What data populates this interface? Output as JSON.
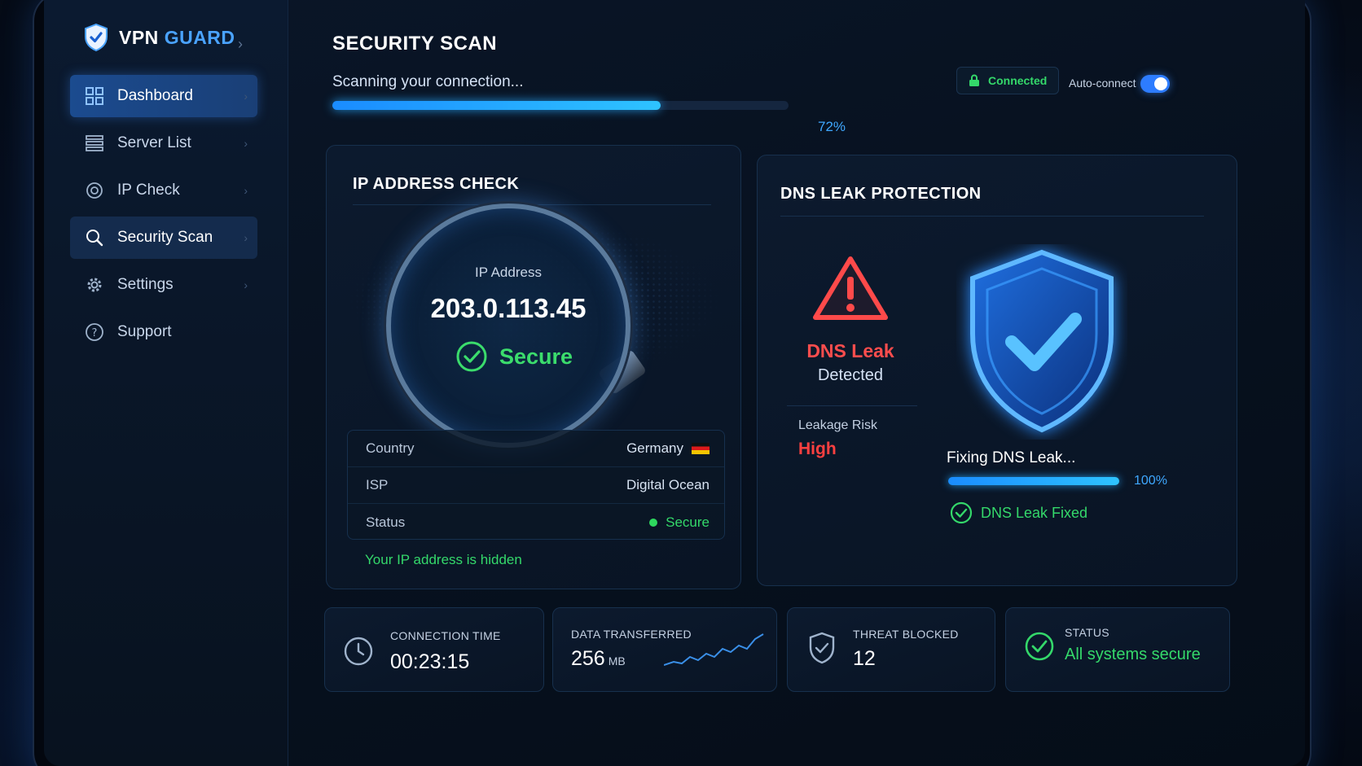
{
  "brand": {
    "name_part1": "VPN",
    "name_part2": "GUARD"
  },
  "sidebar": {
    "items": [
      {
        "label": "Dashboard",
        "icon": "grid-icon"
      },
      {
        "label": "Server List",
        "icon": "list-icon"
      },
      {
        "label": "IP Check",
        "icon": "ip-check-icon"
      },
      {
        "label": "Security Scan",
        "icon": "search-icon"
      },
      {
        "label": "Settings",
        "icon": "gear-icon"
      },
      {
        "label": "Support",
        "icon": "help-icon"
      }
    ]
  },
  "header": {
    "title": "SECURITY SCAN",
    "scan_status": "Scanning your connection...",
    "progress": 72,
    "progress_label": "72%",
    "connection_badge": "Connected",
    "autoconnect_label": "Auto-connect",
    "autoconnect_on": true
  },
  "ip_check": {
    "title": "IP ADDRESS CHECK",
    "ip_label": "IP Address",
    "ip_value": "203.0.113.45",
    "secure_label": "Secure",
    "rows": [
      {
        "key": "Country",
        "value": "Germany"
      },
      {
        "key": "ISP",
        "value": "Digital Ocean"
      },
      {
        "key": "Status",
        "value": "Secure"
      }
    ],
    "hidden_message": "Your IP address is hidden"
  },
  "dns": {
    "title": "DNS LEAK PROTECTION",
    "leak_title": "DNS Leak",
    "leak_status": "Detected",
    "risk_label": "Leakage Risk",
    "risk_value": "High",
    "fixing_label": "Fixing DNS Leak...",
    "fix_progress": 100,
    "fix_progress_label": "100%",
    "fixed_message": "DNS Leak Fixed"
  },
  "stats": {
    "connection_time": {
      "label": "CONNECTION TIME",
      "value": "00:23:15"
    },
    "data_transferred": {
      "label": "DATA TRANSFERRED",
      "value": "256",
      "unit": "MB"
    },
    "threat_blocked": {
      "label": "THREAT BLOCKED",
      "value": "12"
    },
    "status": {
      "label": "STATUS",
      "value": "All systems secure"
    }
  },
  "colors": {
    "accent": "#2d8cff",
    "success": "#34d86a",
    "danger": "#ff4040",
    "background": "#07111f"
  }
}
